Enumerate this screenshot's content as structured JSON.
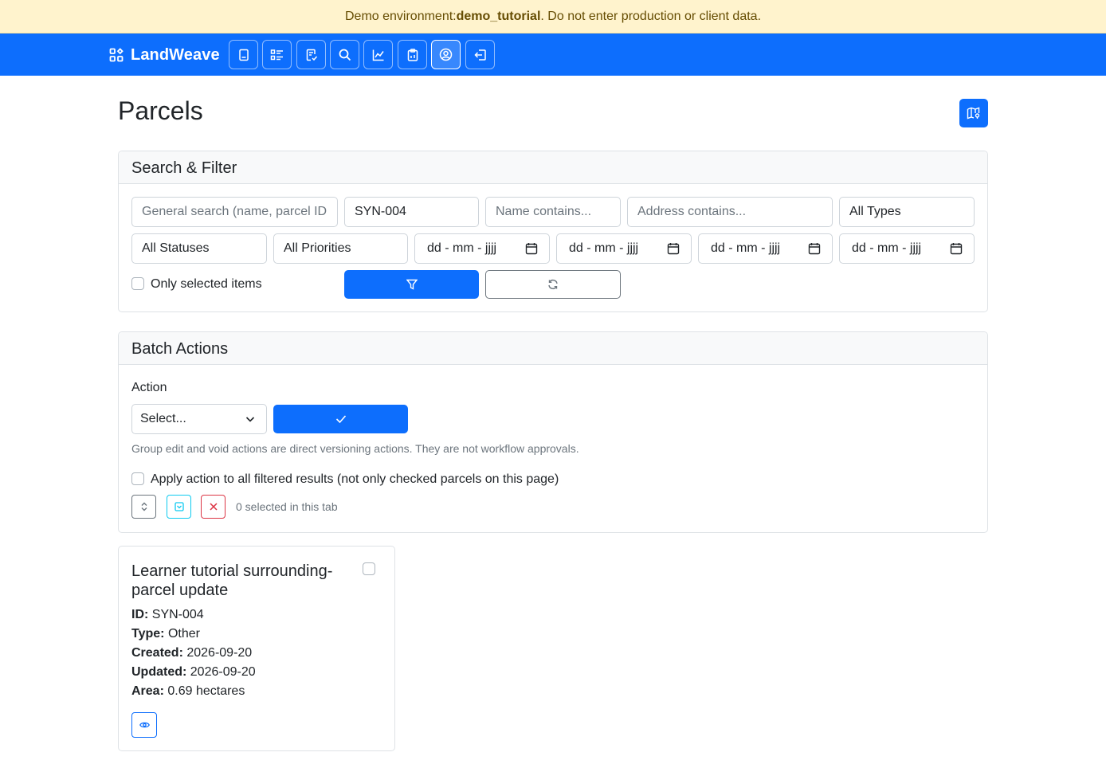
{
  "banner": {
    "prefix": "Demo environment: ",
    "environment": "demo_tutorial",
    "suffix": ". Do not enter production or client data."
  },
  "navbar": {
    "brand": "LandWeave",
    "icons": [
      "book-icon",
      "list-check-icon",
      "file-check-icon",
      "search-icon",
      "chart-icon",
      "clipboard-icon",
      "user-circle-icon",
      "logout-icon"
    ],
    "active_index": 6
  },
  "page": {
    "title": "Parcels"
  },
  "search_filter": {
    "header": "Search & Filter",
    "general_search_placeholder": "General search (name, parcel ID, e",
    "parcel_id_value": "SYN-004",
    "name_placeholder": "Name contains...",
    "address_placeholder": "Address contains...",
    "type_select": "All Types",
    "status_select": "All Statuses",
    "priority_select": "All Priorities",
    "date_placeholder_1": "dd - mm - jjjj",
    "date_placeholder_2": "dd - mm - jjjj",
    "date_placeholder_3": "dd - mm - jjjj",
    "date_placeholder_4": "dd - mm - jjjj",
    "only_selected_label": "Only selected items"
  },
  "batch_actions": {
    "header": "Batch Actions",
    "action_label": "Action",
    "action_select": "Select...",
    "help_text": "Group edit and void actions are direct versioning actions. They are not workflow approvals.",
    "apply_all_label": "Apply action to all filtered results (not only checked parcels on this page)",
    "selected_count": "0 selected in this tab"
  },
  "parcels": [
    {
      "title": "Learner tutorial surrounding-parcel update",
      "id_label": "ID:",
      "id": "SYN-004",
      "type_label": "Type:",
      "type": "Other",
      "created_label": "Created:",
      "created": "2026-09-20",
      "updated_label": "Updated:",
      "updated": "2026-09-20",
      "area_label": "Area:",
      "area": "0.69 hectares"
    }
  ],
  "colors": {
    "primary": "#0d6efd",
    "banner_bg": "#fff3cd",
    "banner_text": "#664d03",
    "info": "#0dcaf0",
    "danger": "#dc3545"
  }
}
